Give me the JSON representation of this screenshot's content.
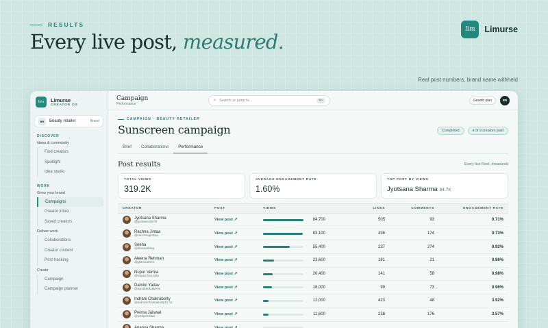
{
  "hero": {
    "eyebrow": "RESULTS",
    "headline_plain": "Every live post, ",
    "headline_emph": "measured.",
    "brand_logo_text": "lim",
    "brand_name": "Limurse",
    "note": "Real post numbers, brand name withheld"
  },
  "sidebar": {
    "logo_text": "lim",
    "app_name": "Limurse",
    "app_sub": "CREATOR OS",
    "org": {
      "initials": "BR",
      "name": "Beauty retailer",
      "tag": "Brand"
    },
    "sections": [
      {
        "title": "DISCOVER",
        "groups": [
          {
            "label": "Ideas & community",
            "items": [
              "Find creators",
              "Spotlight",
              "Idea studio"
            ]
          }
        ]
      },
      {
        "title": "WORK",
        "groups": [
          {
            "label": "Grow your brand",
            "items": [
              "Campaigns",
              "Creator inbox",
              "Saved creators"
            ]
          },
          {
            "label": "Deliver work",
            "items": [
              "Collaborations",
              "Creator content",
              "Post tracking"
            ]
          },
          {
            "label": "Create",
            "items": [
              "Campaign",
              "Campaign planner"
            ]
          }
        ]
      }
    ],
    "active_item": "Campaigns"
  },
  "topbar": {
    "title": "Campaign",
    "subtitle": "Performance",
    "search_placeholder": "Search or jump to...",
    "search_kbd": "⌘K",
    "plan": "Growth plan",
    "avatar": "BR"
  },
  "campaign": {
    "crumb": "CAMPAIGN · BEAUTY RETAILER",
    "title": "Sunscreen campaign",
    "badges": [
      "Completed",
      "9 of 9 creators paid"
    ],
    "tabs": [
      "Brief",
      "Collaborations",
      "Performance"
    ],
    "active_tab": "Performance",
    "section_title": "Post results",
    "section_note": "Every live Reel, measured"
  },
  "stats": [
    {
      "label": "TOTAL VIEWS",
      "value": "319.2K"
    },
    {
      "label": "AVERAGE ENGAGEMENT RATE",
      "value": "1.60%"
    },
    {
      "label": "TOP POST BY VIEWS",
      "value": "Jyotsana Sharma",
      "sub": "84.7K"
    }
  ],
  "table": {
    "headers": [
      "CREATOR",
      "POST",
      "VIEWS",
      "LIKES",
      "COMMENTS",
      "ENGAGEMENT RATE"
    ],
    "view_label": "View post ↗",
    "max_views": 84700,
    "rows": [
      {
        "name": "Jyotsana Sharma",
        "handle": "@jyotsana3579",
        "views": "84,700",
        "views_n": 84700,
        "likes": "505",
        "comments": "93",
        "rate": "0.71%"
      },
      {
        "name": "Rachna Jintaa",
        "handle": "@racchnajinttaa",
        "views": "83,100",
        "views_n": 83100,
        "likes": "436",
        "comments": "174",
        "rate": "0.73%"
      },
      {
        "name": "Sneha",
        "handle": "@lifeesetblog",
        "views": "55,400",
        "views_n": 55400,
        "likes": "237",
        "comments": "274",
        "rate": "0.92%"
      },
      {
        "name": "Aleena Rehman",
        "handle": "@glamxaleen",
        "views": "23,600",
        "views_n": 23600,
        "likes": "181",
        "comments": "21",
        "rate": "0.86%"
      },
      {
        "name": "Nupur Verma",
        "handle": "@nupur.fms.slde",
        "views": "20,400",
        "views_n": 20400,
        "likes": "141",
        "comments": "58",
        "rate": "0.98%"
      },
      {
        "name": "Damini Yadav",
        "handle": "@aesthetikdamini",
        "views": "18,000",
        "views_n": 18000,
        "likes": "99",
        "comments": "73",
        "rate": "0.96%"
      },
      {
        "name": "Indrani Chakraborty",
        "handle": "@indranichakraborty11.11",
        "views": "12,000",
        "views_n": 12000,
        "likes": "423",
        "comments": "48",
        "rate": "3.92%"
      },
      {
        "name": "Prerna Jaiswal",
        "handle": "@withprernaa",
        "views": "11,600",
        "views_n": 11600,
        "likes": "238",
        "comments": "176",
        "rate": "3.57%"
      },
      {
        "name": "Ananya Sharma",
        "handle": "",
        "views": "",
        "views_n": 0,
        "likes": "",
        "comments": "",
        "rate": ""
      }
    ]
  },
  "colors": {
    "accent": "#23897c",
    "bg": "#cfe7e2",
    "panel": "#f4f8f7"
  }
}
